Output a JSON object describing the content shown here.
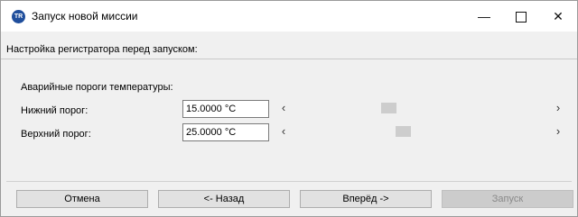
{
  "window": {
    "app_icon_text": "TR",
    "title": "Запуск новой миссии",
    "minimize_glyph": "—",
    "close_glyph": "✕"
  },
  "header": {
    "text": "Настройка регистратора перед запуском:"
  },
  "thresholds": {
    "section_label": "Аварийные пороги температуры:",
    "lower": {
      "label": "Нижний порог:",
      "value": "15.0000 °C",
      "slider_position": 0.37
    },
    "upper": {
      "label": "Верхний порог:",
      "value": "25.0000 °C",
      "slider_position": 0.43
    },
    "arrow_left": "‹",
    "arrow_right": "›"
  },
  "buttons": {
    "cancel": "Отмена",
    "back": "<- Назад",
    "next": "Вперёд ->",
    "start": "Запуск"
  },
  "colors": {
    "app_icon": "#1f4e9c",
    "disabled_text": "#8a8a8a"
  }
}
